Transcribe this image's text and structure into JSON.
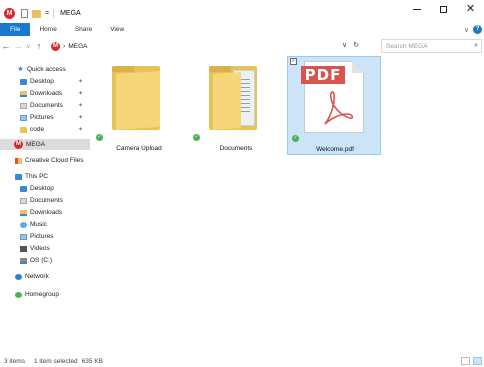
{
  "window": {
    "title": "MEGA",
    "quick_access_dropdown": "=",
    "controls": {
      "minimize": "minimize",
      "maximize": "maximize",
      "close": "✕"
    }
  },
  "ribbon": {
    "tabs": [
      "File",
      "Home",
      "Share",
      "View"
    ],
    "expand": "∨",
    "help": "?"
  },
  "address": {
    "back": "←",
    "forward": "→",
    "history": "∨",
    "up": "↑",
    "separator": "›",
    "path": "MEGA",
    "dropdown": "∨",
    "refresh": "↻",
    "search_placeholder": "Search MEGA",
    "search_icon": "⌕"
  },
  "sidebar": {
    "quick_access": "Quick access",
    "pinned": [
      {
        "label": "Desktop",
        "icon": "desktop-folder-icon"
      },
      {
        "label": "Downloads",
        "icon": "downloads-folder-icon"
      },
      {
        "label": "Documents",
        "icon": "documents-folder-icon"
      },
      {
        "label": "Pictures",
        "icon": "pictures-folder-icon"
      },
      {
        "label": "code",
        "icon": "folder-icon"
      }
    ],
    "pin_glyph": "✦",
    "mega": "MEGA",
    "creative_cloud": "Creative Cloud Files",
    "this_pc": "This PC",
    "pc_items": [
      "Desktop",
      "Documents",
      "Downloads",
      "Music",
      "Pictures",
      "Videos",
      "OS (C:)"
    ],
    "network": "Network",
    "homegroup": "Homegroup"
  },
  "files": [
    {
      "name": "Camera Upload",
      "type": "folder",
      "synced": true,
      "selected": false
    },
    {
      "name": "Documents",
      "type": "folder",
      "synced": true,
      "selected": false
    },
    {
      "name": "Welcome.pdf",
      "type": "pdf",
      "synced": true,
      "selected": true
    }
  ],
  "pdf_banner": "PDF",
  "check_glyph": "✓",
  "status": {
    "items": "3 items",
    "selected": "1 item selected",
    "size": "635 KB"
  },
  "colors": {
    "accent": "#1979ca",
    "selection": "#cce4f7",
    "mega_red": "#d9272e",
    "sync_green": "#4caf50"
  }
}
